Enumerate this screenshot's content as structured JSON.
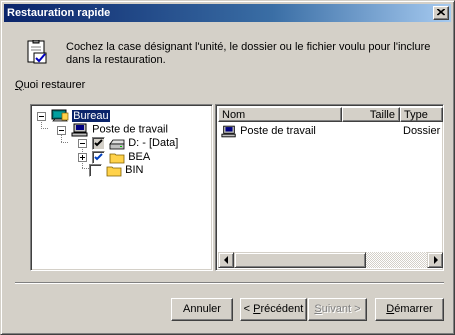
{
  "window": {
    "title": "Restauration rapide",
    "intro": "Cochez la case désignant l'unité, le dossier ou le fichier voulu pour l'inclure dans la restauration.",
    "section_label_accel": "Q",
    "section_label_rest": "uoi restaurer"
  },
  "tree": {
    "items": [
      {
        "label": "Bureau",
        "icon": "desktop-icon",
        "expander": "minus",
        "checkbox": "none",
        "selected": true
      },
      {
        "label": "Poste de travail",
        "icon": "computer-icon",
        "expander": "minus",
        "checkbox": "none"
      },
      {
        "label": "D: - [Data]",
        "icon": "drive-icon",
        "expander": "minus",
        "checkbox": "checked-grey"
      },
      {
        "label": "BEA",
        "icon": "folder-icon",
        "expander": "plus",
        "checkbox": "checked"
      },
      {
        "label": "BIN",
        "icon": "folder-icon",
        "expander": "none",
        "checkbox": "unchecked"
      }
    ]
  },
  "list": {
    "columns": [
      "Nom",
      "Taille",
      "Type"
    ],
    "rows": [
      {
        "name": "Poste de travail",
        "size": "",
        "type": "Dossier",
        "icon": "computer-icon"
      }
    ]
  },
  "buttons": {
    "cancel": "Annuler",
    "prev_prefix": "< ",
    "prev_accel": "P",
    "prev_rest": "récédent",
    "next_accel": "S",
    "next_rest": "uivant >",
    "start_accel": "D",
    "start_rest": "émarrer"
  },
  "colors": {
    "title_bar": "#0a246a",
    "selection": "#0a246a",
    "face": "#d4d0c8",
    "folder": "#ffd24a"
  }
}
